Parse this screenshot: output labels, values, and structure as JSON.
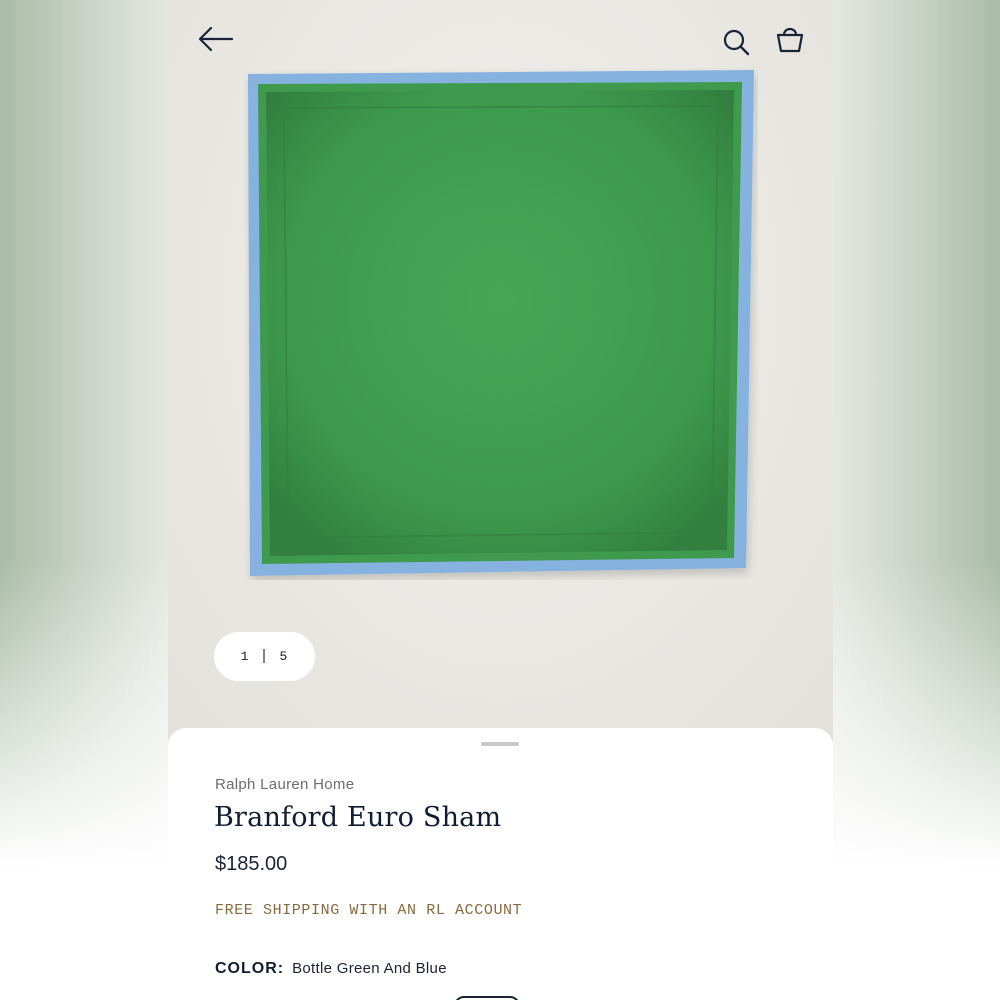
{
  "header": {
    "back_icon": "arrow-left-icon",
    "search_icon": "search-icon",
    "bag_icon": "shopping-bag-icon"
  },
  "gallery": {
    "current": "1",
    "total": "5",
    "separator": "|",
    "colors": {
      "pillow_green": "#3f9a4e",
      "pillow_trim_blue": "#86b2e0",
      "background": "#ecebe6"
    }
  },
  "product": {
    "brand": "Ralph Lauren Home",
    "title": "Branford Euro Sham",
    "price": "$185.00",
    "shipping_note": "FREE SHIPPING WITH AN RL ACCOUNT",
    "color_label": "COLOR:",
    "color_value": "Bottle Green And Blue"
  },
  "theme": {
    "title_color": "#0f1c33",
    "shipping_color": "#8a6a3c"
  }
}
